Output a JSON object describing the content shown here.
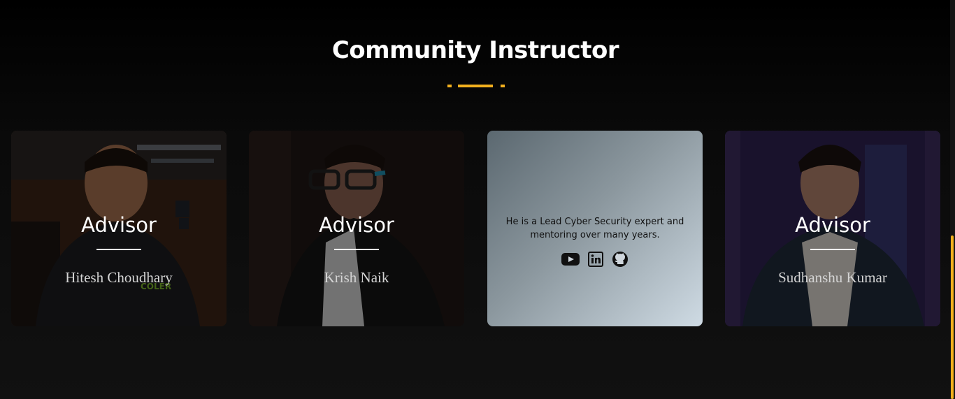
{
  "section": {
    "title": "Community Instructor",
    "accent_color": "#f2b01e"
  },
  "cards": [
    {
      "role": "Advisor",
      "name": "Hitesh Choudhary"
    },
    {
      "role": "Advisor",
      "name": "Krish Naik"
    },
    {
      "description": "He is a Lead Cyber Security expert and mentoring over many years.",
      "socials": [
        "youtube-icon",
        "linkedin-icon",
        "github-icon"
      ]
    },
    {
      "role": "Advisor",
      "name": "Sudhanshu Kumar"
    }
  ]
}
